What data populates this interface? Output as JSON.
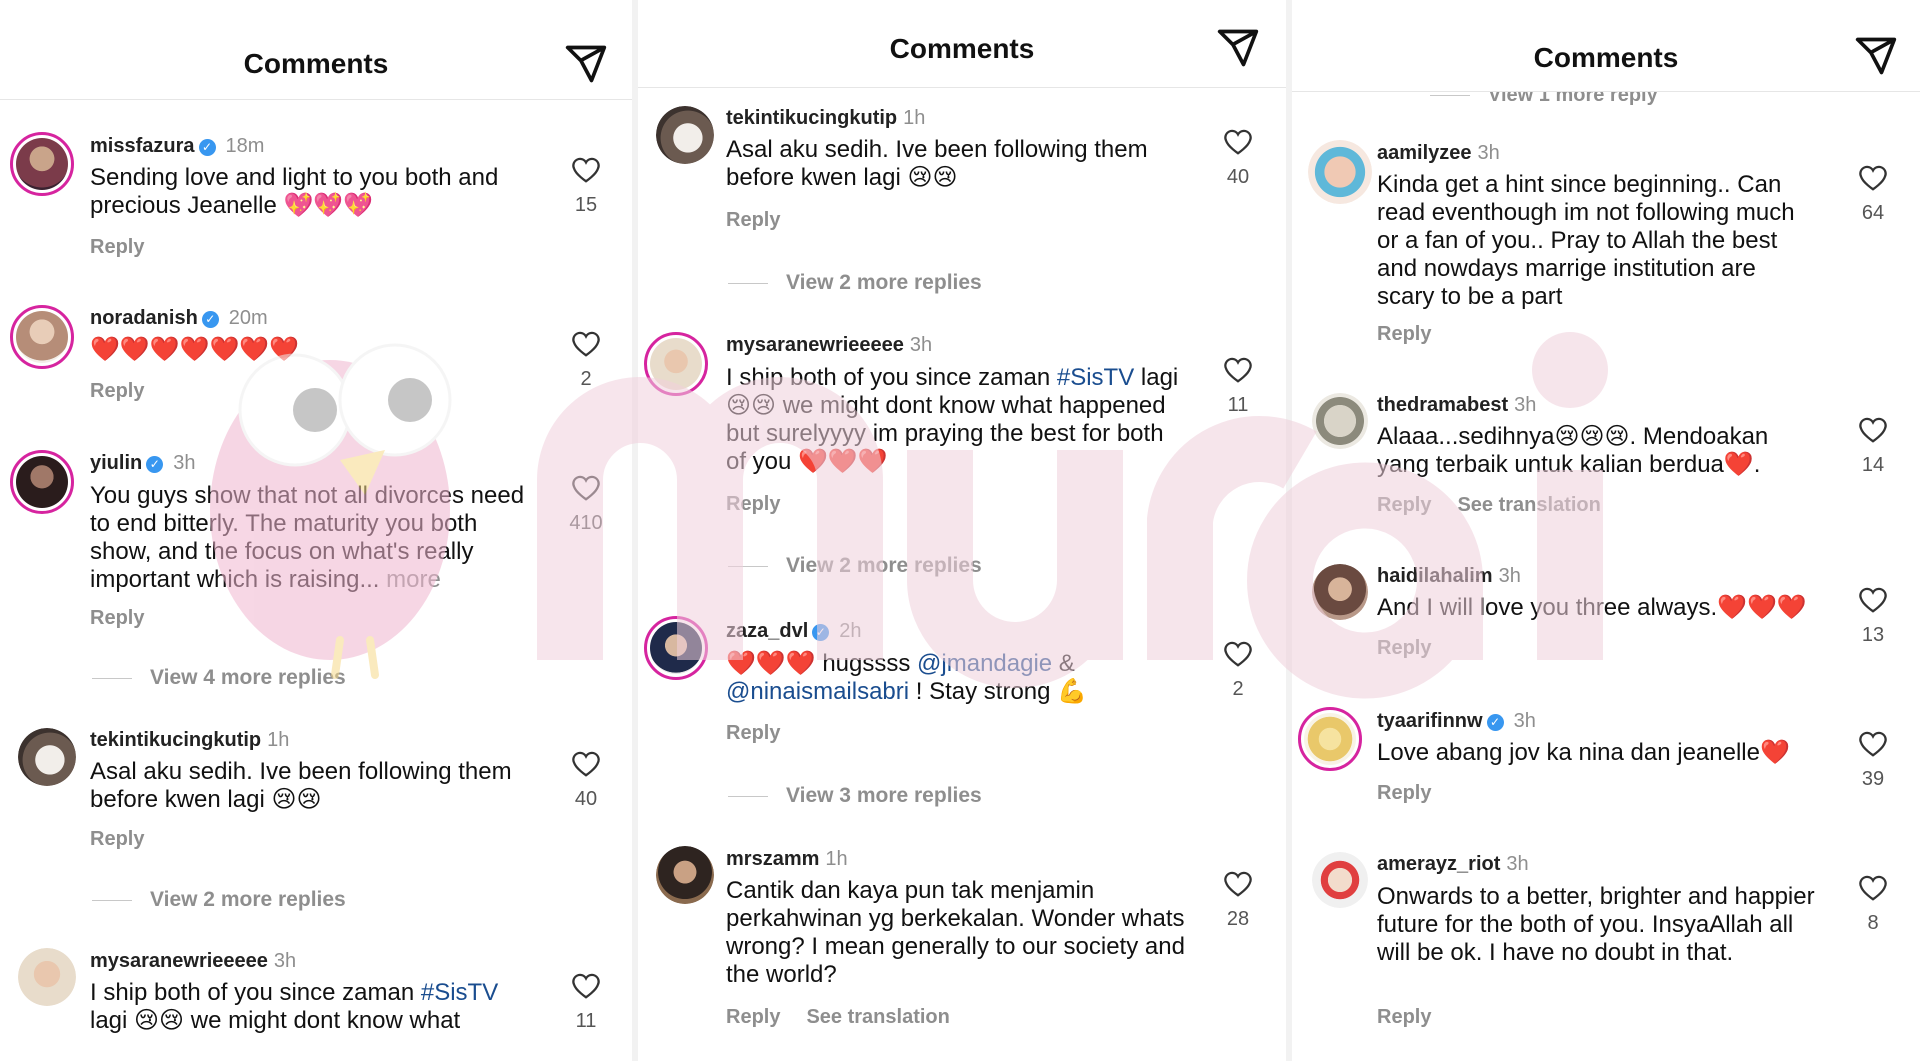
{
  "panels": [
    {
      "title": "Comments",
      "comments": [
        {
          "user": "missfazura",
          "verified": true,
          "time": "18m",
          "text": "Sending love and light to you both and precious Jeanelle 💖💖💖",
          "likes": "15",
          "actions": [
            "Reply"
          ]
        },
        {
          "user": "noradanish",
          "verified": true,
          "time": "20m",
          "text": "❤️❤️❤️❤️❤️❤️❤️",
          "likes": "2",
          "actions": [
            "Reply"
          ]
        },
        {
          "user": "yiulin",
          "verified": true,
          "time": "3h",
          "text": "You guys show that not all divorces need to end bitterly. The maturity you both show, and the focus on what's really important which is raising...",
          "more": "more",
          "likes": "410",
          "actions": [
            "Reply"
          ],
          "view_more": "View 4 more replies"
        },
        {
          "user": "tekintikucingkutip",
          "verified": false,
          "time": "1h",
          "text": "Asal aku sedih. Ive been following them before kwen lagi 😢😢",
          "likes": "40",
          "actions": [
            "Reply"
          ],
          "view_more": "View 2 more replies"
        },
        {
          "user": "mysaranewrieeeee",
          "verified": false,
          "time": "3h",
          "text_before": "I ship both of you since zaman ",
          "tag": "#SisTV",
          "text_after": " lagi 😢😢 we might dont know what",
          "likes": "11"
        }
      ]
    },
    {
      "title": "Comments",
      "comments": [
        {
          "user": "tekintikucingkutip",
          "verified": false,
          "time": "1h",
          "text": "Asal aku sedih. Ive been following them before kwen lagi 😢😢",
          "likes": "40",
          "actions": [
            "Reply"
          ],
          "view_more": "View 2 more replies"
        },
        {
          "user": "mysaranewrieeeee",
          "verified": false,
          "time": "3h",
          "text_before": "I ship both of you since zaman ",
          "tag": "#SisTV",
          "text_after": " lagi 😢😢 we might dont know what happened but surelyyyy im praying the best for both of you ❤️❤️❤️",
          "likes": "11",
          "actions": [
            "Reply"
          ],
          "view_more": "View 2 more replies"
        },
        {
          "user": "zaza_dvl",
          "verified": true,
          "time": "2h",
          "text_before": "❤️❤️❤️ hugssss ",
          "tag": "@jmandagie",
          "text_mid": " & ",
          "tag2": "@ninaismailsabri",
          "text_after": " ! Stay strong 💪",
          "likes": "2",
          "actions": [
            "Reply"
          ],
          "view_more": "View 3 more replies"
        },
        {
          "user": "mrszamm",
          "verified": false,
          "time": "1h",
          "text": "Cantik dan kaya pun tak menjamin perkahwinan yg berkekalan. Wonder whats wrong? I mean generally to our society and the world?",
          "likes": "28",
          "actions": [
            "Reply",
            "See translation"
          ]
        }
      ]
    },
    {
      "title": "Comments",
      "clipped_text": "View 1 more reply",
      "comments": [
        {
          "user": "aamilyzee",
          "verified": false,
          "time": "3h",
          "text": "Kinda get a hint since beginning.. Can read eventhough im not following much or a fan of you.. Pray to Allah the best and nowdays marrige institution are scary to be a part",
          "likes": "64",
          "actions": [
            "Reply"
          ]
        },
        {
          "user": "thedramabest",
          "verified": false,
          "time": "3h",
          "text": "Alaaa...sedihnya😢😢😢. Mendoakan yang terbaik untuk kalian berdua❤️.",
          "likes": "14",
          "actions": [
            "Reply",
            "See translation"
          ]
        },
        {
          "user": "haidilahalim",
          "verified": false,
          "time": "3h",
          "text": "And I will love you three always.❤️❤️❤️",
          "likes": "13",
          "actions": [
            "Reply"
          ]
        },
        {
          "user": "tyaarifinnw",
          "verified": true,
          "time": "3h",
          "text": "Love abang jov ka nina dan jeanelle❤️",
          "likes": "39",
          "actions": [
            "Reply"
          ]
        },
        {
          "user": "amerayz_riot",
          "verified": false,
          "time": "3h",
          "text": "Onwards to a better, brighter and happier future for the both of you. InsyaAllah all will be ok. I have no doubt in that.",
          "likes": "8",
          "actions": [
            "Reply"
          ]
        }
      ]
    }
  ],
  "icons": {
    "send": "send-icon",
    "like": "heart-outline-icon",
    "verified": "verified-badge-icon"
  },
  "watermark": {
    "text": "murai",
    "color": "#f0d0dc"
  },
  "colors": {
    "text": "#111111",
    "muted": "#8e8e8e",
    "link": "#1a4d8f",
    "verified": "#3897f0",
    "story_ring": "#d6249f"
  }
}
